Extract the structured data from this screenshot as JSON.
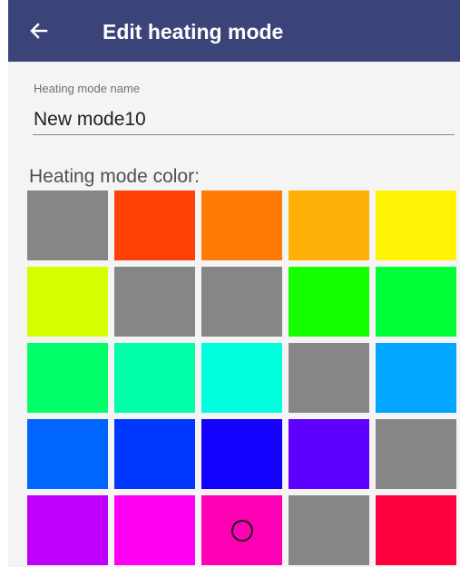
{
  "header": {
    "title": "Edit heating mode",
    "back_icon": "arrow-left-icon",
    "background": "#3b4478"
  },
  "name_field": {
    "label": "Heating mode name",
    "value": "New mode10"
  },
  "color_section": {
    "label": "Heating mode color:",
    "selected_index": 22,
    "swatches": [
      "#868686",
      "#ff4106",
      "#ff7b05",
      "#ffb007",
      "#fff202",
      "#d5ff00",
      "#868686",
      "#868686",
      "#15ff00",
      "#00ff36",
      "#00ff68",
      "#00ffa6",
      "#00ffdd",
      "#868686",
      "#00a6ff",
      "#0066ff",
      "#0037ff",
      "#1300ff",
      "#5d00ff",
      "#868686",
      "#c000ff",
      "#ff00f5",
      "#ff00b5",
      "#868686",
      "#ff0041"
    ]
  }
}
